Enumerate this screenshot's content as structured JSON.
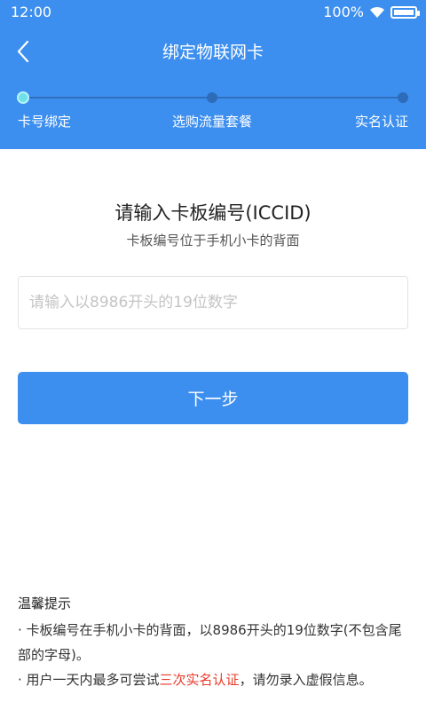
{
  "status_bar": {
    "time": "12:00",
    "battery": "100%",
    "icons": [
      "wifi-icon",
      "battery-icon"
    ]
  },
  "nav": {
    "title": "绑定物联网卡",
    "back_icon": "chevron-left-icon"
  },
  "steps": [
    {
      "label": "卡号绑定",
      "active": true
    },
    {
      "label": "选购流量套餐",
      "active": false
    },
    {
      "label": "实名认证",
      "active": false
    }
  ],
  "form": {
    "title": "请输入卡板编号(ICCID)",
    "subtitle": "卡板编号位于手机小卡的背面",
    "input_placeholder": "请输入以8986开头的19位数字",
    "input_value": "",
    "next_button": "下一步"
  },
  "tips": {
    "title": "温馨提示",
    "tip1": "· 卡板编号在手机小卡的背面，以8986开头的19位数字(不包含尾部的字母)。",
    "tip2_prefix": "· 用户一天内最多可尝试",
    "tip2_highlight": "三次实名认证",
    "tip2_suffix": "，请勿录入虚假信息。"
  },
  "colors": {
    "primary": "#3d8fef",
    "highlight": "#e83a2a",
    "step_active": "#6fe0e8"
  }
}
